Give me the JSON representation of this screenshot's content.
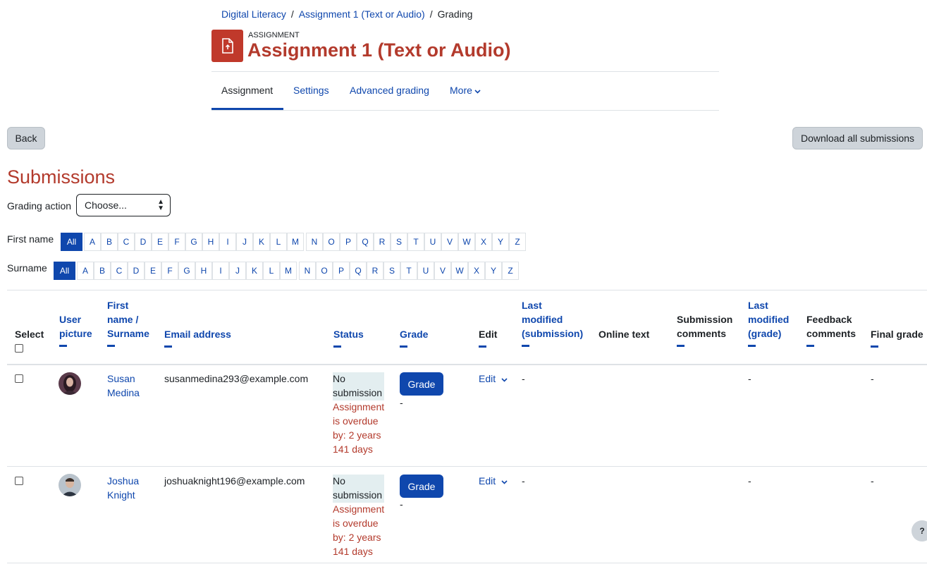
{
  "breadcrumb": {
    "items": [
      "Digital Literacy",
      "Assignment 1 (Text or Audio)",
      "Grading"
    ]
  },
  "activity": {
    "type_label": "ASSIGNMENT",
    "title": "Assignment 1 (Text or Audio)",
    "accent": "#c0392b"
  },
  "tabs": [
    {
      "label": "Assignment"
    },
    {
      "label": "Settings"
    },
    {
      "label": "Advanced grading"
    },
    {
      "label": "More"
    }
  ],
  "buttons": {
    "back": "Back",
    "download": "Download all submissions"
  },
  "submissions_heading": "Submissions",
  "grading_action": {
    "label": "Grading action",
    "selected": "Choose..."
  },
  "initials": {
    "first_name_label": "First name",
    "surname_label": "Surname",
    "all": "All",
    "letters": [
      "A",
      "B",
      "C",
      "D",
      "E",
      "F",
      "G",
      "H",
      "I",
      "J",
      "K",
      "L",
      "M",
      "N",
      "O",
      "P",
      "Q",
      "R",
      "S",
      "T",
      "U",
      "V",
      "W",
      "X",
      "Y",
      "Z"
    ]
  },
  "table": {
    "headers": {
      "select": "Select",
      "user_picture_1": "User",
      "user_picture_2": "picture",
      "name_1": "First",
      "name_2": "name /",
      "name_3": "Surname",
      "email": "Email address",
      "status": "Status",
      "grade": "Grade",
      "edit": "Edit",
      "lastmod_sub_1": "Last",
      "lastmod_sub_2": "modified",
      "lastmod_sub_3": "(submission)",
      "online_text": "Online text",
      "sub_comments_1": "Submission",
      "sub_comments_2": "comments",
      "lastmod_grade_1": "Last",
      "lastmod_grade_2": "modified",
      "lastmod_grade_3": "(grade)",
      "feedback_1": "Feedback",
      "feedback_2": "comments",
      "final_grade": "Final grade"
    },
    "rows": [
      {
        "first": "Susan",
        "last": "Medina",
        "email": "susanmedina293@example.com",
        "status_1": "No",
        "status_2": "submission",
        "overdue_1": "Assignment",
        "overdue_2": "is overdue",
        "overdue_3": "by: 2 years",
        "overdue_4": "141 days",
        "grade_button": "Grade",
        "grade_value": "-",
        "edit": "Edit",
        "lastmod_sub": "-",
        "lastmod_grade": "-",
        "final_grade": "-"
      },
      {
        "first": "Joshua",
        "last": "Knight",
        "email": "joshuaknight196@example.com",
        "status_1": "No",
        "status_2": "submission",
        "overdue_1": "Assignment",
        "overdue_2": "is overdue",
        "overdue_3": "by: 2 years",
        "overdue_4": "141 days",
        "grade_button": "Grade",
        "grade_value": "-",
        "edit": "Edit",
        "lastmod_sub": "-",
        "lastmod_grade": "-",
        "final_grade": "-"
      }
    ]
  },
  "help_button": "?"
}
